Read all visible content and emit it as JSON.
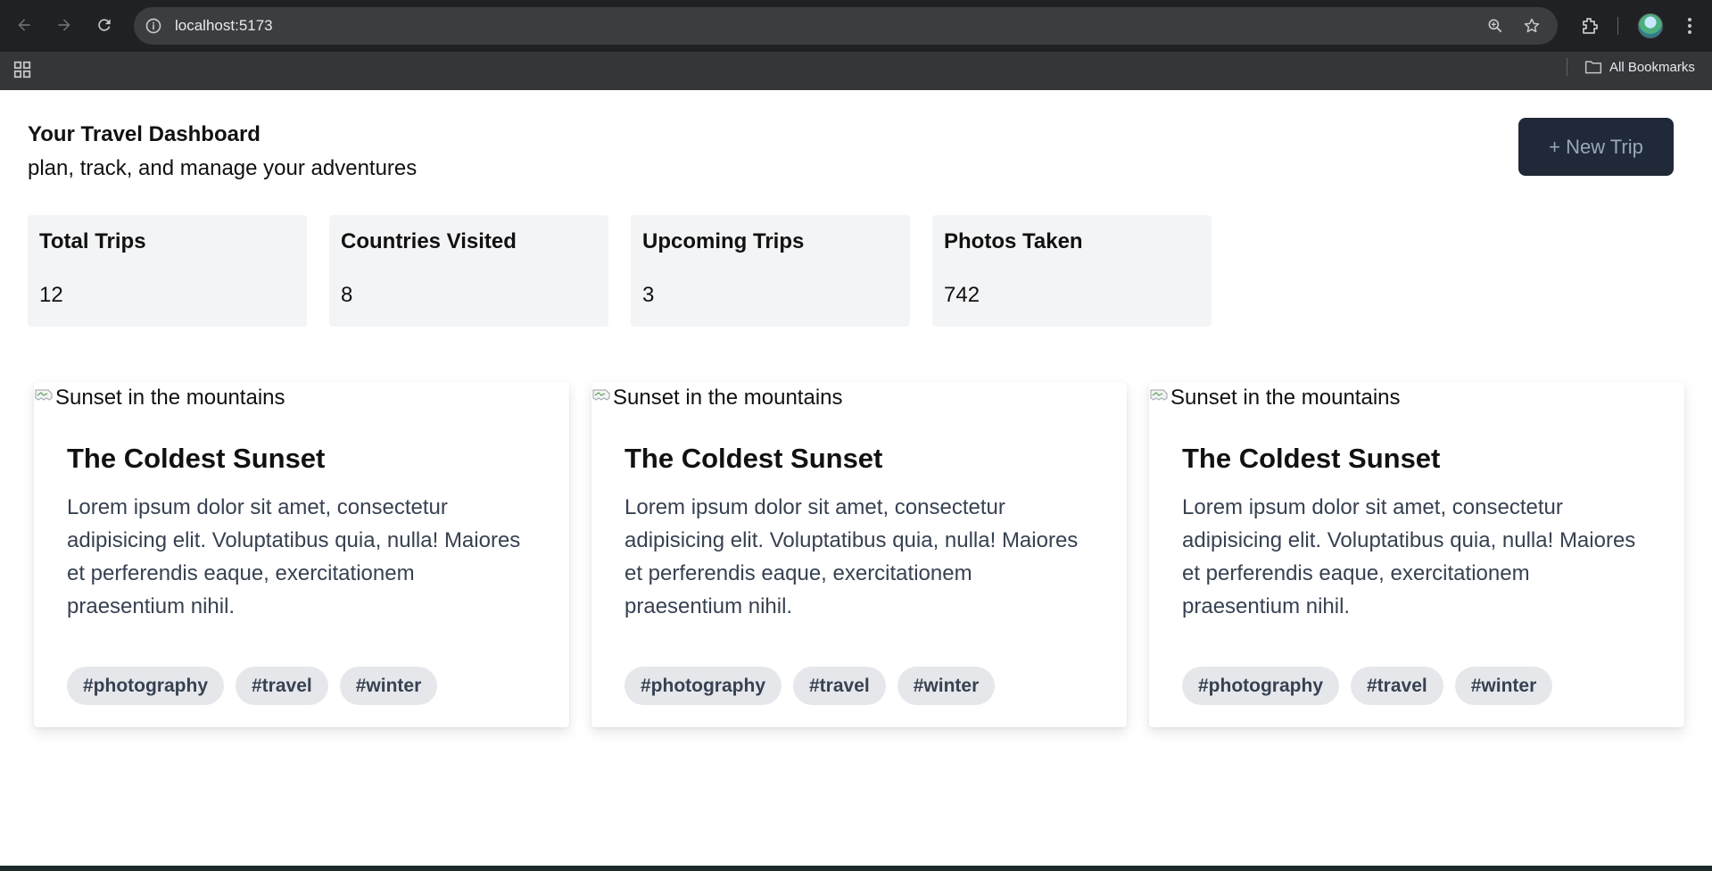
{
  "browser": {
    "url": "localhost:5173",
    "bookmarks_label": "All Bookmarks"
  },
  "header": {
    "title": "Your Travel Dashboard",
    "subtitle": "plan, track, and manage your adventures",
    "new_trip_label": "+ New Trip"
  },
  "stats": [
    {
      "label": "Total Trips",
      "value": "12"
    },
    {
      "label": "Countries Visited",
      "value": "8"
    },
    {
      "label": "Upcoming Trips",
      "value": "3"
    },
    {
      "label": "Photos Taken",
      "value": "742"
    }
  ],
  "cards": [
    {
      "image_alt": "Sunset in the mountains",
      "title": "The Coldest Sunset",
      "text": "Lorem ipsum dolor sit amet, consectetur adipisicing elit. Voluptatibus quia, nulla! Maiores et perferendis eaque, exercitationem praesentium nihil.",
      "tags": [
        "#photography",
        "#travel",
        "#winter"
      ]
    },
    {
      "image_alt": "Sunset in the mountains",
      "title": "The Coldest Sunset",
      "text": "Lorem ipsum dolor sit amet, consectetur adipisicing elit. Voluptatibus quia, nulla! Maiores et perferendis eaque, exercitationem praesentium nihil.",
      "tags": [
        "#photography",
        "#travel",
        "#winter"
      ]
    },
    {
      "image_alt": "Sunset in the mountains",
      "title": "The Coldest Sunset",
      "text": "Lorem ipsum dolor sit amet, consectetur adipisicing elit. Voluptatibus quia, nulla! Maiores et perferendis eaque, exercitationem praesentium nihil.",
      "tags": [
        "#photography",
        "#travel",
        "#winter"
      ]
    }
  ],
  "colors": {
    "chrome_bg": "#202124",
    "bookmark_bar_bg": "#35363a",
    "button_bg": "#1f2937",
    "stat_bg": "#f3f4f6",
    "tag_bg": "#e5e7eb"
  }
}
